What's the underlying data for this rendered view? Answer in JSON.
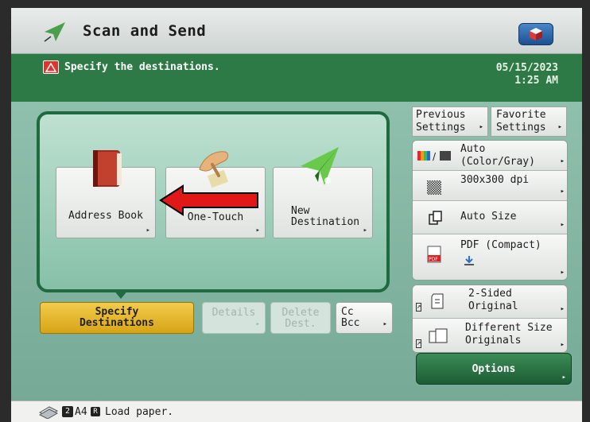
{
  "header": {
    "title": "Scan and Send",
    "message": "Specify the destinations.",
    "date": "05/15/2023",
    "time": "1:25 AM"
  },
  "destination_buttons": [
    {
      "label": "Address Book",
      "icon": "address-book-icon"
    },
    {
      "label": "One-Touch",
      "icon": "one-touch-hand-icon"
    },
    {
      "label": "New\nDestination",
      "label_line1": "New",
      "label_line2": "Destination",
      "icon": "paper-plane-icon"
    }
  ],
  "tabs": {
    "specify_line1": "Specify",
    "specify_line2": "Destinations",
    "details": "Details",
    "delete_line1": "Delete",
    "delete_line2": "Dest.",
    "cc": "Cc",
    "bcc": "Bcc"
  },
  "right_panel": {
    "previous_line1": "Previous",
    "previous_line2": "Settings",
    "favorite_line1": "Favorite",
    "favorite_line2": "Settings",
    "color_line1": "Auto",
    "color_line2": "(Color/Gray)",
    "resolution": "300x300 dpi",
    "size": "Auto Size",
    "format": "PDF (Compact)",
    "sided_line1": "2-Sided",
    "sided_line2": "Original",
    "diffsize_line1": "Different Size",
    "diffsize_line2": "Originals",
    "options": "Options"
  },
  "status": {
    "badge1": "2",
    "paper": "A4",
    "badge2": "R",
    "message": "Load paper."
  },
  "colors": {
    "accent_green": "#2e7a46",
    "selected_yellow": "#e9b62c",
    "annotation_red": "#e01818"
  }
}
